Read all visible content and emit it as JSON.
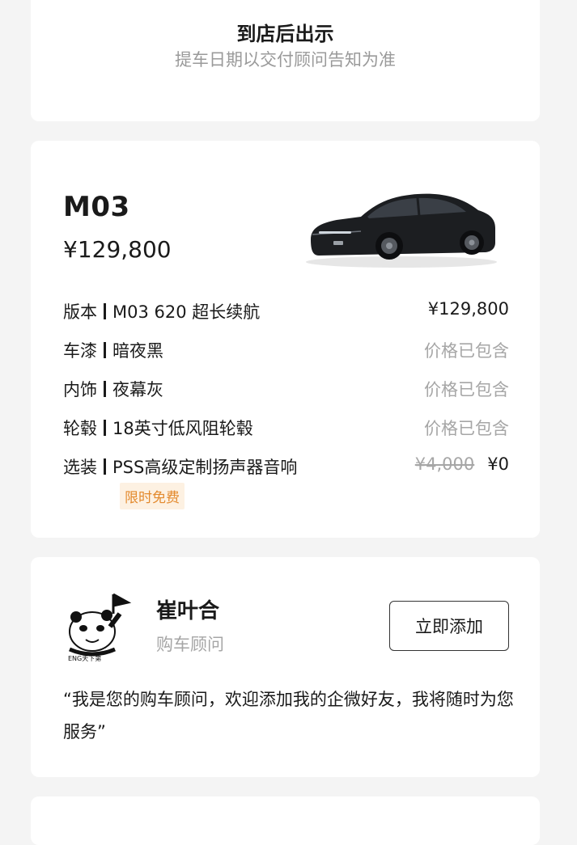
{
  "pickup": {
    "title": "到店后出示",
    "subtitle": "提车日期以交付顾问告知为准"
  },
  "order": {
    "model": "M03",
    "price": "¥129,800",
    "specs": [
      {
        "label": "版本",
        "value": "M03 620 超长续航",
        "right": "¥129,800"
      },
      {
        "label": "车漆",
        "value": "暗夜黑",
        "right": "价格已包含"
      },
      {
        "label": "内饰",
        "value": "夜幕灰",
        "right": "价格已包含"
      },
      {
        "label": "轮毂",
        "value": "18英寸低风阻轮毂",
        "right": "价格已包含"
      },
      {
        "label": "选装",
        "value": "PSS高级定制扬声器音响",
        "original_price": "¥4,000",
        "right": "¥0"
      }
    ],
    "badge": "限时免费",
    "badge_color": "#e38a2e"
  },
  "advisor": {
    "name": "崔叶合",
    "role": "购车顾问",
    "button": "立即添加",
    "message": "“我是您的购车顾问，欢迎添加我的企微好友，我将随时为您服务”",
    "avatar_text": "ENG天下第"
  }
}
